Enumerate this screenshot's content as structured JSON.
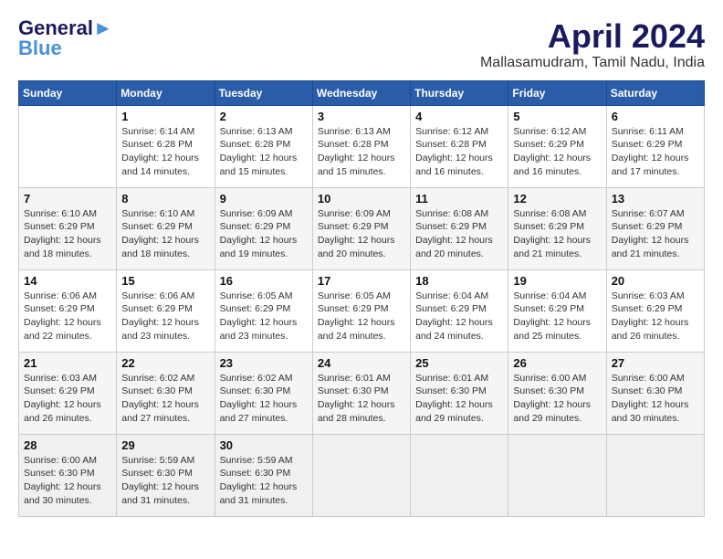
{
  "header": {
    "logo_line1": "General",
    "logo_line2": "Blue",
    "month": "April 2024",
    "location": "Mallasamudram, Tamil Nadu, India"
  },
  "weekdays": [
    "Sunday",
    "Monday",
    "Tuesday",
    "Wednesday",
    "Thursday",
    "Friday",
    "Saturday"
  ],
  "weeks": [
    [
      {
        "day": "",
        "info": ""
      },
      {
        "day": "1",
        "info": "Sunrise: 6:14 AM\nSunset: 6:28 PM\nDaylight: 12 hours\nand 14 minutes."
      },
      {
        "day": "2",
        "info": "Sunrise: 6:13 AM\nSunset: 6:28 PM\nDaylight: 12 hours\nand 15 minutes."
      },
      {
        "day": "3",
        "info": "Sunrise: 6:13 AM\nSunset: 6:28 PM\nDaylight: 12 hours\nand 15 minutes."
      },
      {
        "day": "4",
        "info": "Sunrise: 6:12 AM\nSunset: 6:28 PM\nDaylight: 12 hours\nand 16 minutes."
      },
      {
        "day": "5",
        "info": "Sunrise: 6:12 AM\nSunset: 6:29 PM\nDaylight: 12 hours\nand 16 minutes."
      },
      {
        "day": "6",
        "info": "Sunrise: 6:11 AM\nSunset: 6:29 PM\nDaylight: 12 hours\nand 17 minutes."
      }
    ],
    [
      {
        "day": "7",
        "info": "Sunrise: 6:10 AM\nSunset: 6:29 PM\nDaylight: 12 hours\nand 18 minutes."
      },
      {
        "day": "8",
        "info": "Sunrise: 6:10 AM\nSunset: 6:29 PM\nDaylight: 12 hours\nand 18 minutes."
      },
      {
        "day": "9",
        "info": "Sunrise: 6:09 AM\nSunset: 6:29 PM\nDaylight: 12 hours\nand 19 minutes."
      },
      {
        "day": "10",
        "info": "Sunrise: 6:09 AM\nSunset: 6:29 PM\nDaylight: 12 hours\nand 20 minutes."
      },
      {
        "day": "11",
        "info": "Sunrise: 6:08 AM\nSunset: 6:29 PM\nDaylight: 12 hours\nand 20 minutes."
      },
      {
        "day": "12",
        "info": "Sunrise: 6:08 AM\nSunset: 6:29 PM\nDaylight: 12 hours\nand 21 minutes."
      },
      {
        "day": "13",
        "info": "Sunrise: 6:07 AM\nSunset: 6:29 PM\nDaylight: 12 hours\nand 21 minutes."
      }
    ],
    [
      {
        "day": "14",
        "info": "Sunrise: 6:06 AM\nSunset: 6:29 PM\nDaylight: 12 hours\nand 22 minutes."
      },
      {
        "day": "15",
        "info": "Sunrise: 6:06 AM\nSunset: 6:29 PM\nDaylight: 12 hours\nand 23 minutes."
      },
      {
        "day": "16",
        "info": "Sunrise: 6:05 AM\nSunset: 6:29 PM\nDaylight: 12 hours\nand 23 minutes."
      },
      {
        "day": "17",
        "info": "Sunrise: 6:05 AM\nSunset: 6:29 PM\nDaylight: 12 hours\nand 24 minutes."
      },
      {
        "day": "18",
        "info": "Sunrise: 6:04 AM\nSunset: 6:29 PM\nDaylight: 12 hours\nand 24 minutes."
      },
      {
        "day": "19",
        "info": "Sunrise: 6:04 AM\nSunset: 6:29 PM\nDaylight: 12 hours\nand 25 minutes."
      },
      {
        "day": "20",
        "info": "Sunrise: 6:03 AM\nSunset: 6:29 PM\nDaylight: 12 hours\nand 26 minutes."
      }
    ],
    [
      {
        "day": "21",
        "info": "Sunrise: 6:03 AM\nSunset: 6:29 PM\nDaylight: 12 hours\nand 26 minutes."
      },
      {
        "day": "22",
        "info": "Sunrise: 6:02 AM\nSunset: 6:30 PM\nDaylight: 12 hours\nand 27 minutes."
      },
      {
        "day": "23",
        "info": "Sunrise: 6:02 AM\nSunset: 6:30 PM\nDaylight: 12 hours\nand 27 minutes."
      },
      {
        "day": "24",
        "info": "Sunrise: 6:01 AM\nSunset: 6:30 PM\nDaylight: 12 hours\nand 28 minutes."
      },
      {
        "day": "25",
        "info": "Sunrise: 6:01 AM\nSunset: 6:30 PM\nDaylight: 12 hours\nand 29 minutes."
      },
      {
        "day": "26",
        "info": "Sunrise: 6:00 AM\nSunset: 6:30 PM\nDaylight: 12 hours\nand 29 minutes."
      },
      {
        "day": "27",
        "info": "Sunrise: 6:00 AM\nSunset: 6:30 PM\nDaylight: 12 hours\nand 30 minutes."
      }
    ],
    [
      {
        "day": "28",
        "info": "Sunrise: 6:00 AM\nSunset: 6:30 PM\nDaylight: 12 hours\nand 30 minutes."
      },
      {
        "day": "29",
        "info": "Sunrise: 5:59 AM\nSunset: 6:30 PM\nDaylight: 12 hours\nand 31 minutes."
      },
      {
        "day": "30",
        "info": "Sunrise: 5:59 AM\nSunset: 6:30 PM\nDaylight: 12 hours\nand 31 minutes."
      },
      {
        "day": "",
        "info": ""
      },
      {
        "day": "",
        "info": ""
      },
      {
        "day": "",
        "info": ""
      },
      {
        "day": "",
        "info": ""
      }
    ]
  ]
}
